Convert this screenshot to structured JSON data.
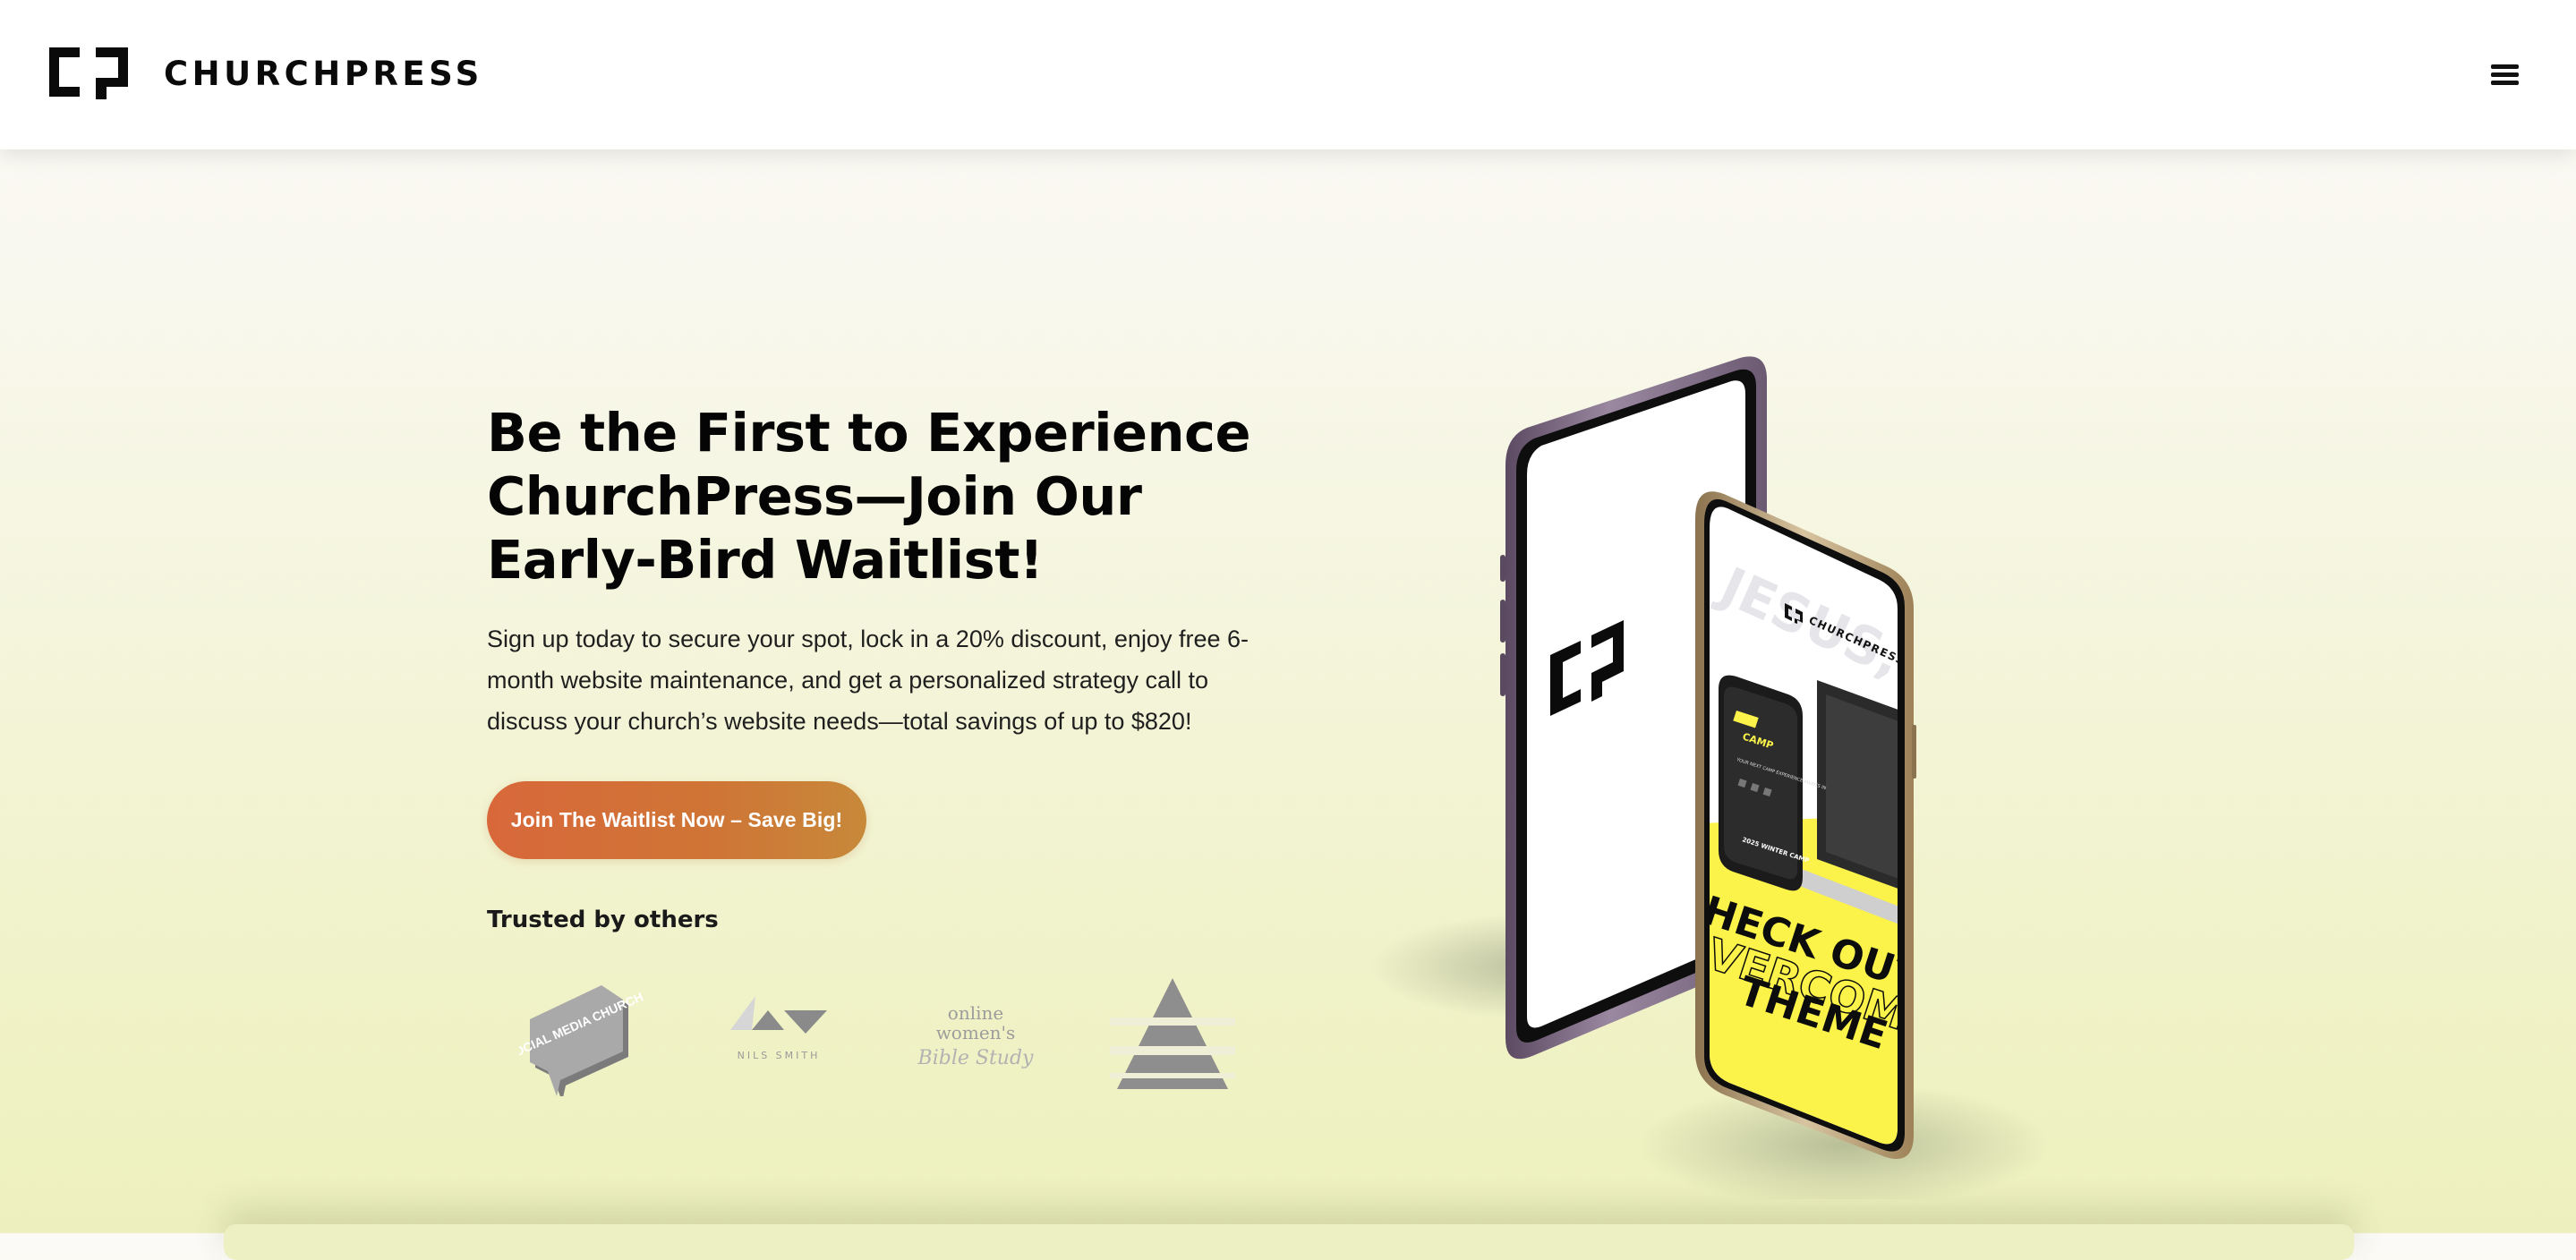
{
  "header": {
    "brand_name": "CHURCHPRESS",
    "logo_icon": "churchpress-bracket-icon",
    "menu_icon": "hamburger-menu-icon"
  },
  "hero": {
    "title": "Be the First to Experience ChurchPress—Join Our Early-Bird Waitlist!",
    "description": "Sign up today to secure your spot, lock in a 20% discount, enjoy free 6-month website maintenance, and get a personalized strategy call to discuss your church’s website needs—total savings of up to $820!",
    "cta_label": "Join The Waitlist Now – Save Big!",
    "trusted_heading": "Trusted by others"
  },
  "partners": [
    {
      "icon": "social-media-church-logo",
      "label": "SOCIAL MEDIA CHURCH"
    },
    {
      "icon": "nils-smith-logo",
      "label": "NILS SMITH"
    },
    {
      "icon": "online-womens-bible-study-logo",
      "label": "online women's Bible Study"
    },
    {
      "icon": "triangle-a-logo",
      "label": ""
    }
  ],
  "phones": {
    "front_brand": "CHURCHPRESS",
    "front_bg_text": "JESUS, AND T",
    "inner_card_title": "CAMP",
    "inner_card_subtitle": "YOUR NEXT CAMP EXPERIENCE AWAITS IN",
    "inner_card_footer": "2025 WINTER CAMP",
    "banner_line1": "HECK OUT TH",
    "banner_line2": "VERCOME",
    "banner_line3": "THEME"
  },
  "colors": {
    "cta_start": "#d8683a",
    "cta_end": "#c7893a",
    "phone_yellow": "#fbf34a",
    "phone_frame_purple": "#6e5a76",
    "phone_frame_gold": "#b89a6e"
  }
}
